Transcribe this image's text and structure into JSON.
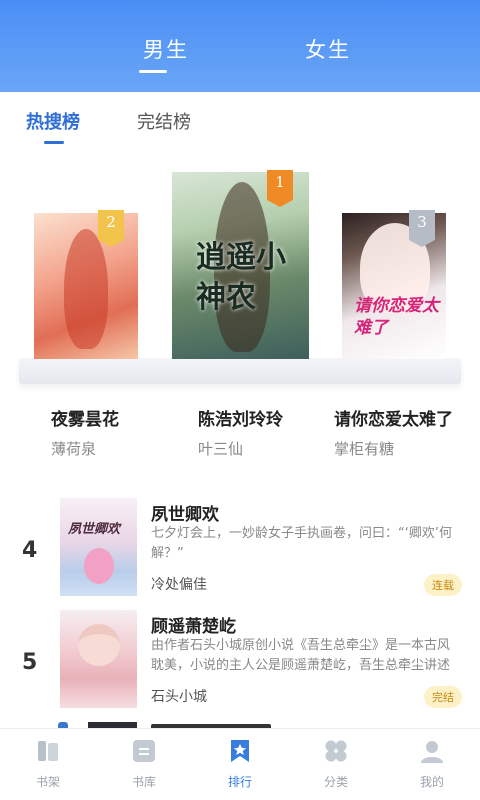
{
  "header": {
    "tabs": [
      {
        "label": "男生",
        "active": true
      },
      {
        "label": "女生",
        "active": false
      }
    ],
    "background_color": "#4a8ef5"
  },
  "subtabs": [
    {
      "label": "热搜榜",
      "active": true
    },
    {
      "label": "完结榜",
      "active": false
    }
  ],
  "podium": [
    {
      "rank": "2",
      "title": "夜雾昙花",
      "author": "薄荷泉"
    },
    {
      "rank": "1",
      "title": "陈浩刘玲玲",
      "author": "叶三仙",
      "cover_title": "逍遥小神农"
    },
    {
      "rank": "3",
      "title": "请你恋爱太难了",
      "author": "掌柜有糖",
      "cover_title": "请你恋爱太难了"
    }
  ],
  "list": [
    {
      "rank": "4",
      "title": "夙世卿欢",
      "description": "七夕灯会上，一妙龄女子手执画卷，问曰：“‘卿欢’何解？”",
      "author": "冷处偏佳",
      "status": "连载",
      "cover_title": "夙世卿欢"
    },
    {
      "rank": "5",
      "title": "顾遥萧楚屹",
      "description": "由作者石头小城原创小说《吾生总牵尘》是一本古风耽美，小说的主人公是顾遥萧楚屹，吾生总牵尘讲述",
      "author": "石头小城",
      "status": "完结"
    }
  ],
  "tabbar": [
    {
      "label": "书架",
      "icon": "bookshelf-icon",
      "active": false
    },
    {
      "label": "书库",
      "icon": "library-icon",
      "active": false
    },
    {
      "label": "排行",
      "icon": "ranking-bookmark-icon",
      "active": true
    },
    {
      "label": "分类",
      "icon": "category-grid-icon",
      "active": false
    },
    {
      "label": "我的",
      "icon": "profile-icon",
      "active": false
    }
  ],
  "colors": {
    "accent": "#3a7de0",
    "badge_bg": "#fdf1c8",
    "badge_text": "#c88a10",
    "rank1": "#f08a24",
    "rank2": "#f3c44b",
    "rank3": "#b5bcc6"
  }
}
